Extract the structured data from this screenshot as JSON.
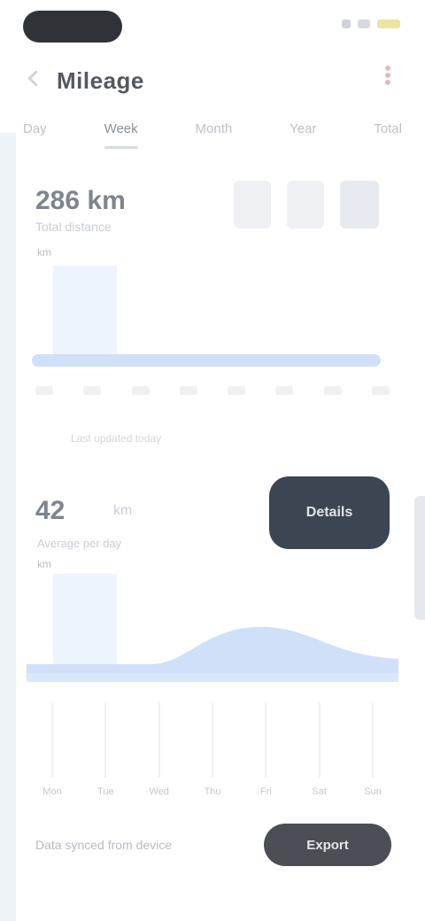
{
  "status_bar": {
    "time": ""
  },
  "header": {
    "title": "Mileage",
    "back_icon": "chevron-left-icon",
    "menu_icon": "more-vertical-icon"
  },
  "tabs": [
    {
      "label": "Day"
    },
    {
      "label": "Week",
      "active": true
    },
    {
      "label": "Month"
    },
    {
      "label": "Year"
    },
    {
      "label": "Total"
    }
  ],
  "card_summary": {
    "value": "286 km",
    "subtitle": "Total distance",
    "axis_label": "km",
    "caption": "Last updated today"
  },
  "card_detail": {
    "value": "42",
    "unit": "km",
    "subtitle": "Average per day",
    "axis_label": "km",
    "button_label": "Details",
    "columns": [
      "Mon",
      "Tue",
      "Wed",
      "Thu",
      "Fri",
      "Sat",
      "Sun"
    ]
  },
  "footer": {
    "text": "Data synced from device",
    "button_label": "Export"
  },
  "colors": {
    "accent": "#cfe0f8",
    "dark_button": "#3c4652",
    "footer_button": "#4b4f55"
  }
}
